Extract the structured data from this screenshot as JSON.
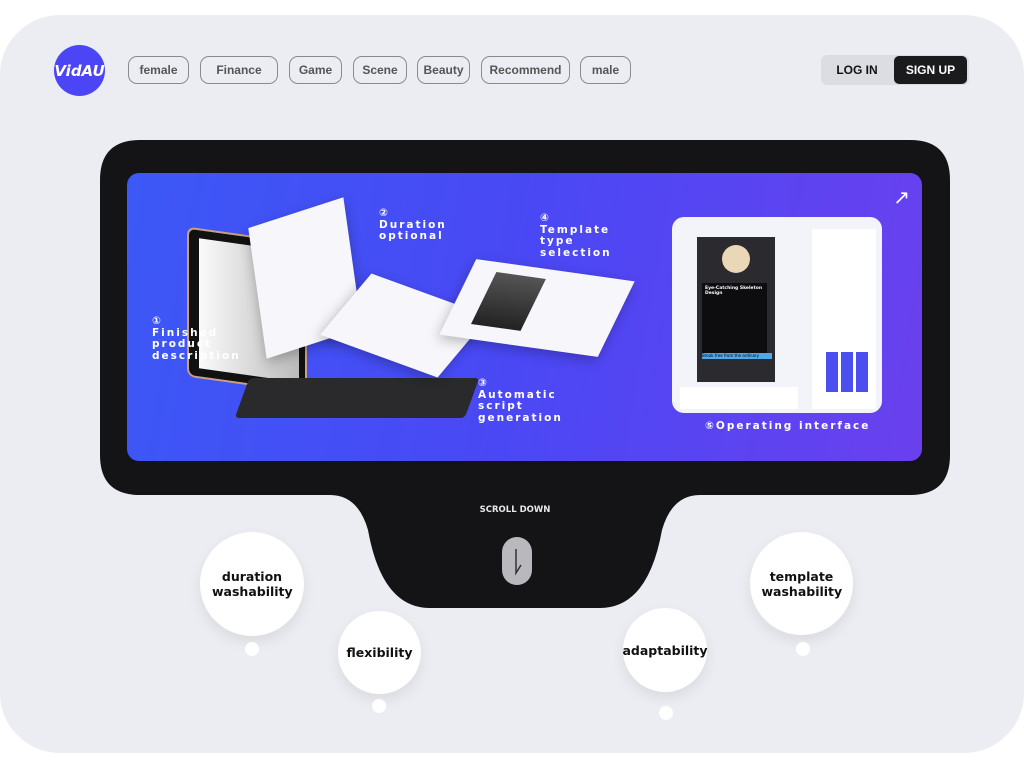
{
  "logo": "VidAU",
  "tags": [
    "female",
    "Finance",
    "Game",
    "Scene",
    "Beauty",
    "Recommend",
    "male"
  ],
  "auth": {
    "login": "LOG IN",
    "signup": "SIGN UP"
  },
  "banner": {
    "steps": [
      {
        "num": "①",
        "label": "Finished product description"
      },
      {
        "num": "②",
        "label": "Duration optional"
      },
      {
        "num": "③",
        "label": "Automatic script generation"
      },
      {
        "num": "④",
        "label": "Template type selection"
      }
    ],
    "operating": "⑤Operating interface",
    "op_preview_title": "Eye-Catching Skeleton Design",
    "op_preview_caption": "Break free from the ordinary",
    "arrow_icon": "arrow-up-right-icon"
  },
  "scroll": {
    "label": "SCROLL DOWN"
  },
  "bubbles": [
    "duration washability",
    "flexibility",
    "adaptability",
    "template washability"
  ],
  "colors": {
    "brand": "#4b45f5",
    "frame": "#141416",
    "background": "#ecedf2"
  }
}
